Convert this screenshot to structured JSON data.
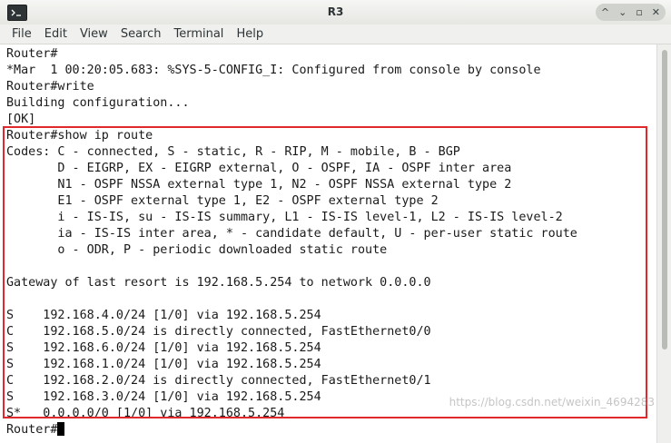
{
  "window": {
    "title": "R3",
    "controls": {
      "minimize_symbol": "^",
      "shade_symbol": "⌄",
      "maximize_symbol": "▫",
      "close_symbol": "✕"
    }
  },
  "menu": [
    "File",
    "Edit",
    "View",
    "Search",
    "Terminal",
    "Help"
  ],
  "terminal_lines": [
    "Router#",
    "*Mar  1 00:20:05.683: %SYS-5-CONFIG_I: Configured from console by console",
    "Router#write",
    "Building configuration...",
    "[OK]",
    "Router#show ip route",
    "Codes: C - connected, S - static, R - RIP, M - mobile, B - BGP",
    "       D - EIGRP, EX - EIGRP external, O - OSPF, IA - OSPF inter area",
    "       N1 - OSPF NSSA external type 1, N2 - OSPF NSSA external type 2",
    "       E1 - OSPF external type 1, E2 - OSPF external type 2",
    "       i - IS-IS, su - IS-IS summary, L1 - IS-IS level-1, L2 - IS-IS level-2",
    "       ia - IS-IS inter area, * - candidate default, U - per-user static route",
    "       o - ODR, P - periodic downloaded static route",
    "",
    "Gateway of last resort is 192.168.5.254 to network 0.0.0.0",
    "",
    "S    192.168.4.0/24 [1/0] via 192.168.5.254",
    "C    192.168.5.0/24 is directly connected, FastEthernet0/0",
    "S    192.168.6.0/24 [1/0] via 192.168.5.254",
    "S    192.168.1.0/24 [1/0] via 192.168.5.254",
    "C    192.168.2.0/24 is directly connected, FastEthernet0/1",
    "S    192.168.3.0/24 [1/0] via 192.168.5.254",
    "S*   0.0.0.0/0 [1/0] via 192.168.5.254"
  ],
  "prompt": "Router#",
  "watermark": "https://blog.csdn.net/weixin_4694283"
}
